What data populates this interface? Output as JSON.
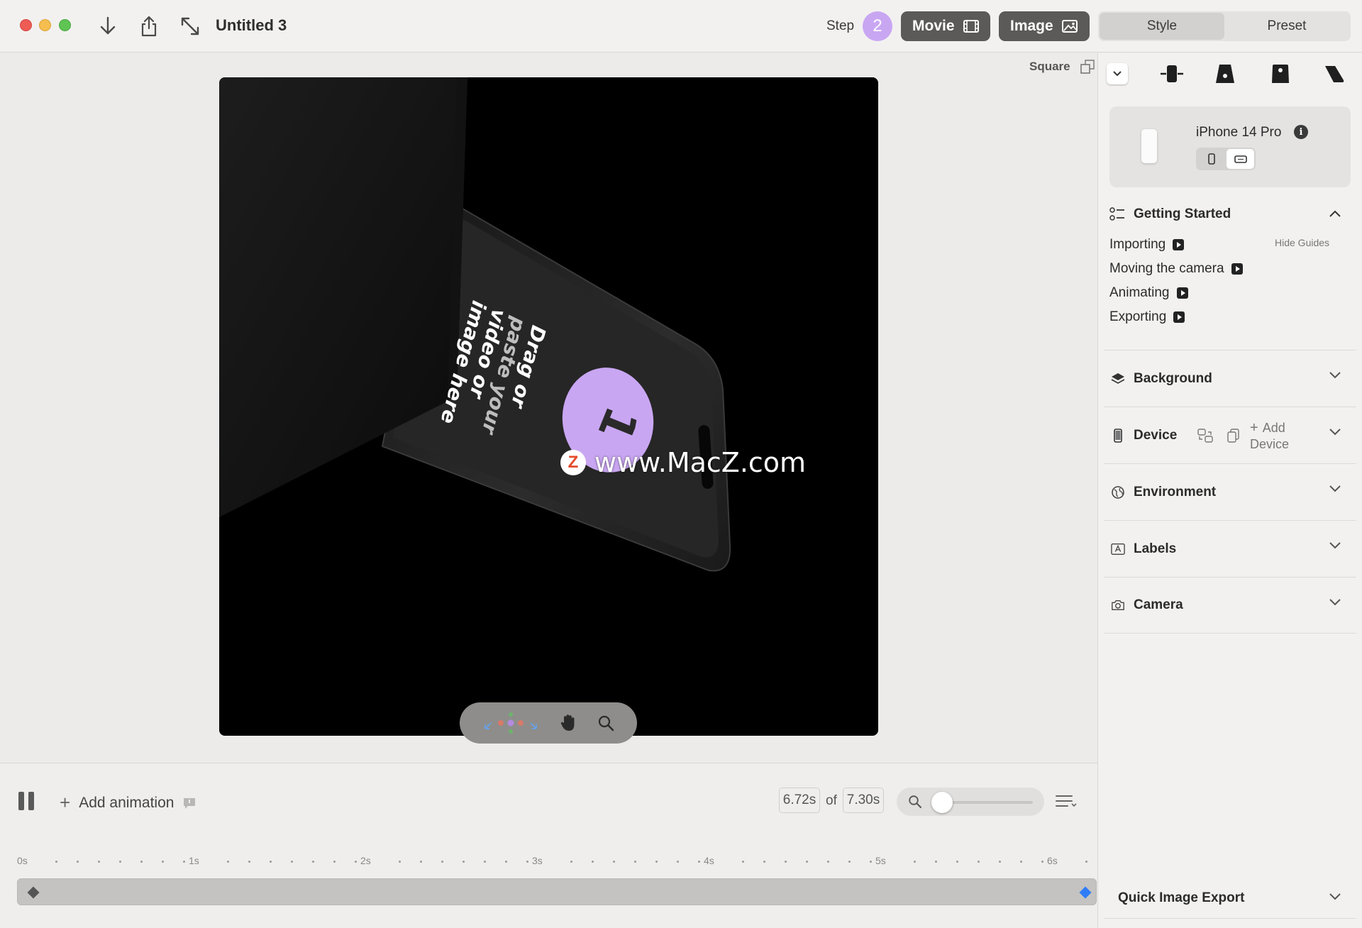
{
  "window": {
    "title": "Untitled 3",
    "step_label": "Step",
    "step_number": "2",
    "movie_label": "Movie",
    "image_label": "Image",
    "tabs": [
      "Style",
      "Preset"
    ],
    "active_tab": "Style"
  },
  "canvas": {
    "aspect_label": "Square",
    "placeholder_text": [
      "Drag or",
      "paste your",
      "video or",
      "image here"
    ],
    "watermark": "www.MacZ.com",
    "watermark_logo": "Z",
    "drop_number": "1"
  },
  "timeline": {
    "add_animation_label": "Add animation",
    "current_time": "6.72s",
    "of_label": "of",
    "total_time": "7.30s",
    "zoom_level": 0.1,
    "ruler": [
      "0s",
      "1s",
      "2s",
      "3s",
      "4s",
      "5s",
      "6s"
    ]
  },
  "sidebar": {
    "device": {
      "name": "iPhone 14 Pro",
      "orientation": "landscape"
    },
    "getting_started": {
      "title": "Getting Started",
      "hide_guides": "Hide Guides",
      "items": [
        "Importing",
        "Moving the camera",
        "Animating",
        "Exporting"
      ]
    },
    "sections": {
      "background": "Background",
      "device": "Device",
      "add_device": [
        "Add",
        "Device"
      ],
      "environment": "Environment",
      "labels": "Labels",
      "camera": "Camera"
    },
    "quick_export": "Quick Image Export"
  },
  "colors": {
    "accent_purple": "#c9a6f2",
    "dark_button": "#5b5a59",
    "keyframe_blue": "#2f7cf6"
  }
}
